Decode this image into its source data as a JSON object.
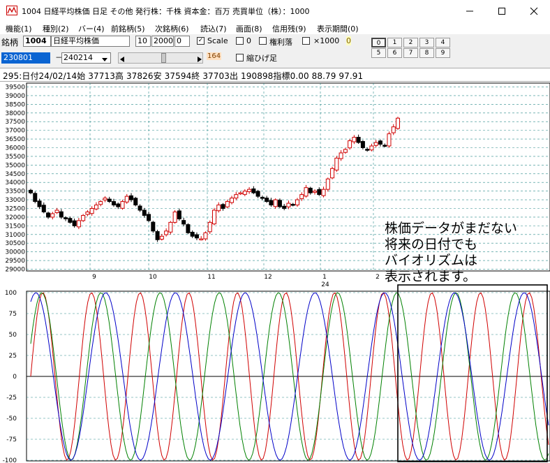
{
  "window": {
    "title": "1004 日経平均株価  日足  その他  発行株：千株  資本金：百万  売買単位（株）：1000"
  },
  "menu": [
    "機能(1)",
    "種別(2)",
    "バー(4)",
    "前銘柄(5)",
    "次銘柄(6)",
    "読込(7)",
    "画面(8)",
    "信用残(9)",
    "表示期間(0)"
  ],
  "toolbar": {
    "code_label": "銘柄",
    "code_value": "1004",
    "name_value": "日経平均株価",
    "param1": "10",
    "param2": "2000",
    "param3": "0",
    "scale_label": "Scale",
    "zero_label": "0",
    "kenri_label": "権利落",
    "x1000_label": "×1000",
    "x1000_value": "0",
    "from_date": "230801",
    "to_date": "240214",
    "count_value": "164",
    "shrink_label": "縮ひげ足",
    "num_buttons_row1": [
      "0",
      "1",
      "2",
      "3",
      "4"
    ],
    "num_buttons_row2": [
      "5",
      "6",
      "7",
      "8",
      "9"
    ]
  },
  "info": {
    "text": "295:日付24/02/14始 37713高 37826安 37594終 37703出 190898指標0.00  88.79  97.91"
  },
  "annotation": [
    "株価データがまだない",
    "将来の日付でも",
    "バイオリズムは",
    "表示されます。"
  ],
  "chart_data": [
    {
      "type": "candlestick",
      "y_ticks": [
        39500,
        39000,
        38500,
        38000,
        37500,
        37000,
        36500,
        36000,
        35500,
        35000,
        34500,
        34000,
        33500,
        33000,
        32500,
        32000,
        31500,
        31000,
        30500,
        30000,
        29500,
        29000
      ],
      "ylim": [
        28900,
        39600
      ],
      "x_tick_labels": [
        "9",
        "10",
        "11",
        "12",
        "1",
        "2"
      ],
      "year_label": "24",
      "grid": true,
      "close_series": [
        33400,
        32900,
        32600,
        32300,
        32000,
        32200,
        32400,
        32000,
        31900,
        31700,
        31500,
        31800,
        32100,
        32300,
        32500,
        32700,
        32900,
        33100,
        32900,
        32700,
        32600,
        32900,
        33200,
        33000,
        32700,
        32400,
        32100,
        31800,
        31200,
        30700,
        30900,
        31200,
        31700,
        32300,
        31900,
        31600,
        31100,
        30900,
        30800,
        30750,
        31100,
        31700,
        32400,
        32700,
        32500,
        32900,
        33100,
        33300,
        33400,
        33500,
        33600,
        33400,
        33200,
        33100,
        32900,
        32700,
        33000,
        32600,
        32500,
        32800,
        32700,
        33000,
        33300,
        33700,
        33400,
        33500,
        33300,
        33600,
        34200,
        34800,
        35400,
        35700,
        35900,
        36400,
        36600,
        36300,
        36000,
        35900,
        36100,
        36300,
        36200,
        36100,
        36800,
        37200,
        37700
      ]
    },
    {
      "type": "line",
      "y_ticks": [
        100,
        75,
        50,
        25,
        0,
        -25,
        -50,
        -75,
        -100
      ],
      "ylim": [
        -100,
        100
      ],
      "series": [
        {
          "color": "#d00000",
          "period_days": 23,
          "phase": 0.0
        },
        {
          "color": "#008000",
          "period_days": 28,
          "phase": 0.4
        },
        {
          "color": "#0000c8",
          "period_days": 33,
          "phase": 1.1
        }
      ]
    }
  ]
}
